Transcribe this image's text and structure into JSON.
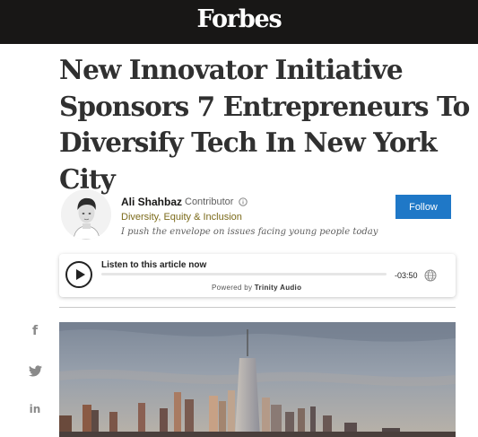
{
  "header": {
    "logo_text": "Forbes",
    "bg_color": "#181716"
  },
  "article": {
    "headline": "New Innovator Initiative Sponsors 7 Entrepreneurs To Diversify Tech In New York City"
  },
  "author": {
    "name": "Ali Shahbaz",
    "role": "Contributor",
    "topic": "Diversity, Equity & Inclusion",
    "bio": "I push the envelope on issues facing young people today",
    "follow_label": "Follow",
    "topic_color": "#7b6a1a",
    "follow_color": "#1f78c7"
  },
  "audio_player": {
    "label": "Listen to this article now",
    "time_remaining": "-03:50",
    "powered_by_prefix": "Powered by",
    "powered_by_brand": "Trinity Audio",
    "progress_fraction": 0.0
  },
  "share": {
    "icons": [
      "facebook-icon",
      "twitter-icon",
      "linkedin-icon"
    ]
  },
  "hero_image": {
    "subject": "skyline"
  }
}
